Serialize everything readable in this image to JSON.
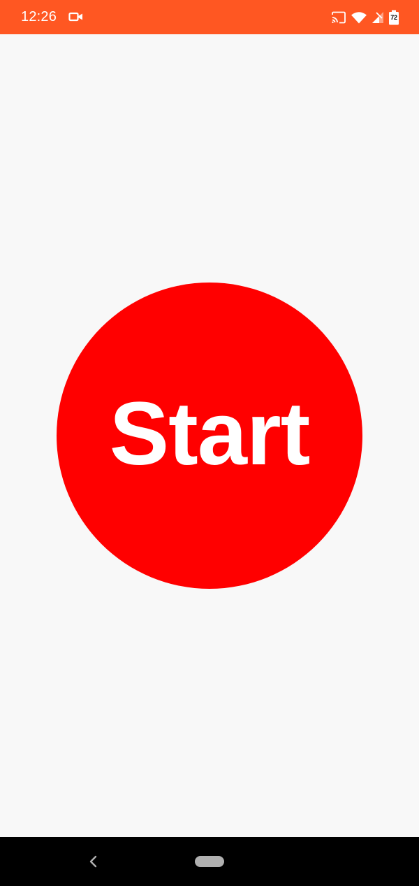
{
  "status_bar": {
    "time": "12:26",
    "battery_level": "72",
    "background_color": "#ff5722",
    "icons": [
      "camera-icon",
      "cast-icon",
      "wifi-icon",
      "cellular-signal-icon",
      "battery-icon"
    ]
  },
  "main": {
    "start_button_label": "Start",
    "start_button_color": "#ff0000",
    "background_color": "#f8f8f8"
  },
  "nav_bar": {
    "background_color": "#000000",
    "icons": [
      "back-icon",
      "home-pill"
    ]
  }
}
